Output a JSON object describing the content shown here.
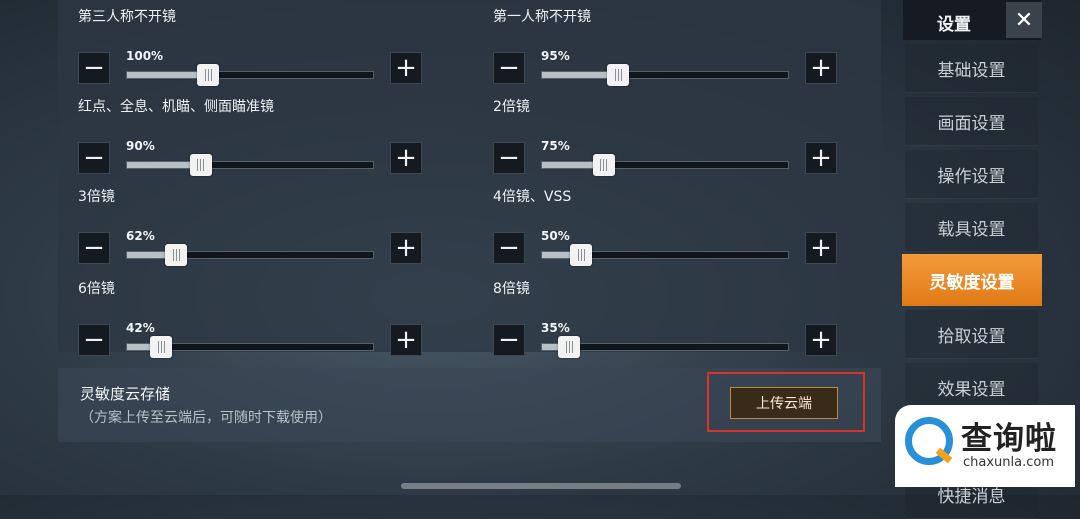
{
  "sliders": [
    {
      "label": "第三人称不开镜",
      "value_text": "100%",
      "level": 0.33
    },
    {
      "label": "第一人称不开镜",
      "value_text": "95%",
      "level": 0.31
    },
    {
      "label": "红点、全息、机瞄、侧面瞄准镜",
      "value_text": "90%",
      "level": 0.3
    },
    {
      "label": "2倍镜",
      "value_text": "75%",
      "level": 0.25
    },
    {
      "label": "3倍镜",
      "value_text": "62%",
      "level": 0.2
    },
    {
      "label": "4倍镜、VSS",
      "value_text": "50%",
      "level": 0.16
    },
    {
      "label": "6倍镜",
      "value_text": "42%",
      "level": 0.14
    },
    {
      "label": "8倍镜",
      "value_text": "35%",
      "level": 0.11
    }
  ],
  "controls": {
    "minus": "−",
    "plus": "+"
  },
  "cloud": {
    "title": "灵敏度云存储",
    "subtitle": "（方案上传至云端后，可随时下载使用）",
    "upload_label": "上传云端"
  },
  "sidebar": {
    "title": "设置",
    "close": "✕",
    "items": [
      {
        "label": "基础设置"
      },
      {
        "label": "画面设置"
      },
      {
        "label": "操作设置"
      },
      {
        "label": "载具设置"
      },
      {
        "label": "灵敏度设置"
      },
      {
        "label": "拾取设置"
      },
      {
        "label": "效果设置"
      },
      {
        "label": "快捷消息"
      }
    ],
    "active_index": 4
  },
  "watermark": {
    "cn": "查询啦",
    "en": "chaxunla.com"
  },
  "colors": {
    "accent": "#e98a2a",
    "highlight": "#d7322b"
  }
}
